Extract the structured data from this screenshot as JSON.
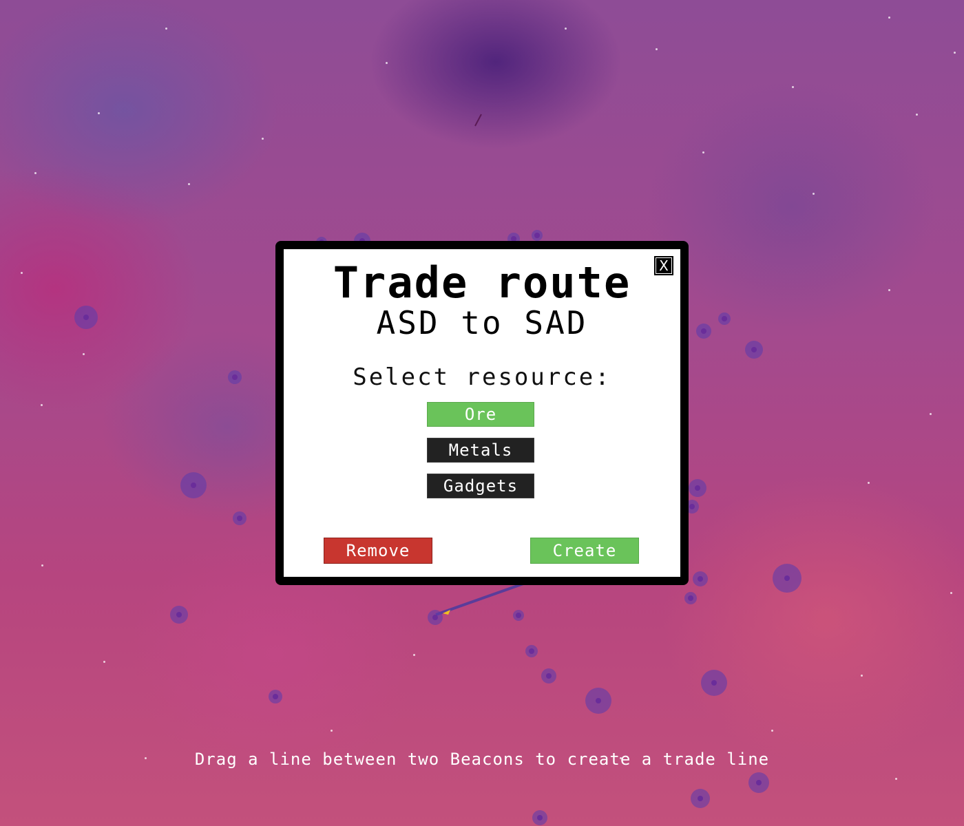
{
  "modal": {
    "title": "Trade route",
    "subtitle": "ASD to SAD",
    "close_label": "X",
    "prompt": "Select resource:",
    "resources": [
      {
        "label": "Ore",
        "selected": true
      },
      {
        "label": "Metals",
        "selected": false
      },
      {
        "label": "Gadgets",
        "selected": false
      }
    ],
    "remove_label": "Remove",
    "create_label": "Create"
  },
  "hint": "Drag a line between two Beacons to create a trade line",
  "colors": {
    "selected": "#6ac35a",
    "unselected": "#222222",
    "remove": "#c8362f",
    "create": "#6ac35a",
    "beacon": "#5f3caa",
    "trade_line": "#5a3c9a"
  }
}
